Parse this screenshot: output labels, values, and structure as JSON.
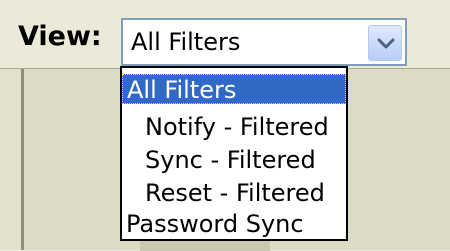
{
  "view": {
    "label": "View:",
    "selected": "All Filters",
    "arrow_icon": "chevron-down-icon"
  },
  "dropdown": {
    "options": [
      "All Filters",
      "Notify - Filtered",
      "Sync - Filtered",
      "Reset - Filtered",
      "Password Sync"
    ]
  },
  "colors": {
    "selection": "#316ac5",
    "selection_text": "#ffffff",
    "focus_outline": "#f9d85a",
    "combo_border": "#7f9db9",
    "background": "#ece9d8"
  }
}
